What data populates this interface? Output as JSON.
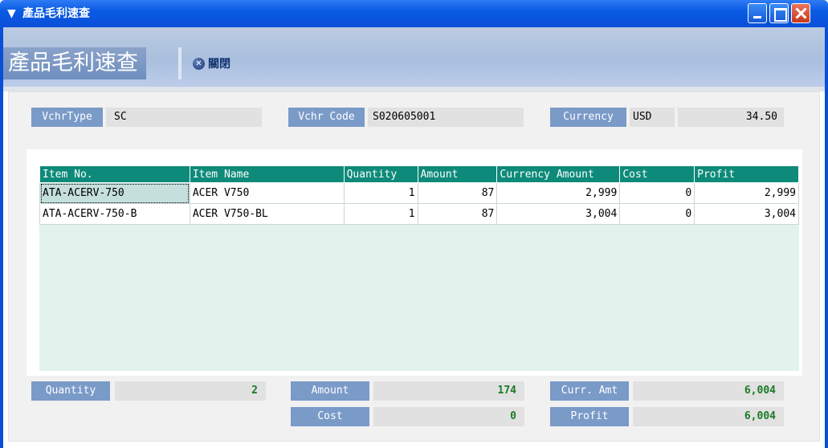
{
  "window": {
    "title": "產品毛利速查",
    "app_icon": "V-icon"
  },
  "header": {
    "page_title": "產品毛利速查",
    "close_label": "關閉"
  },
  "fields": {
    "vchr_type_label": "VchrType",
    "vchr_type_value": "SC",
    "vchr_code_label": "Vchr Code",
    "vchr_code_value": "S020605001",
    "currency_label": "Currency",
    "currency_value": "USD",
    "currency_rate": "34.50"
  },
  "grid": {
    "columns": [
      "Item No.",
      "Item Name",
      "Quantity",
      "Amount",
      "Currency Amount",
      "Cost",
      "Profit"
    ],
    "rows": [
      {
        "item_no": "ATA-ACERV-750",
        "item_name": "ACER V750",
        "quantity": "1",
        "amount": "87",
        "currency_amount": "2,999",
        "cost": "0",
        "profit": "2,999"
      },
      {
        "item_no": "ATA-ACERV-750-B",
        "item_name": "ACER V750-BL",
        "quantity": "1",
        "amount": "87",
        "currency_amount": "3,004",
        "cost": "0",
        "profit": "3,004"
      }
    ]
  },
  "summary": {
    "quantity_label": "Quantity",
    "quantity_value": "2",
    "amount_label": "Amount",
    "amount_value": "174",
    "cost_label": "Cost",
    "cost_value": "0",
    "curr_amt_label": "Curr. Amt",
    "curr_amt_value": "6,004",
    "profit_label": "Profit",
    "profit_value": "6,004"
  },
  "colors": {
    "titlebar": "#0a4fd8",
    "label_bg": "#7a9ac8",
    "grid_header": "#0e8a7a",
    "sum_text": "#1a7a24"
  }
}
